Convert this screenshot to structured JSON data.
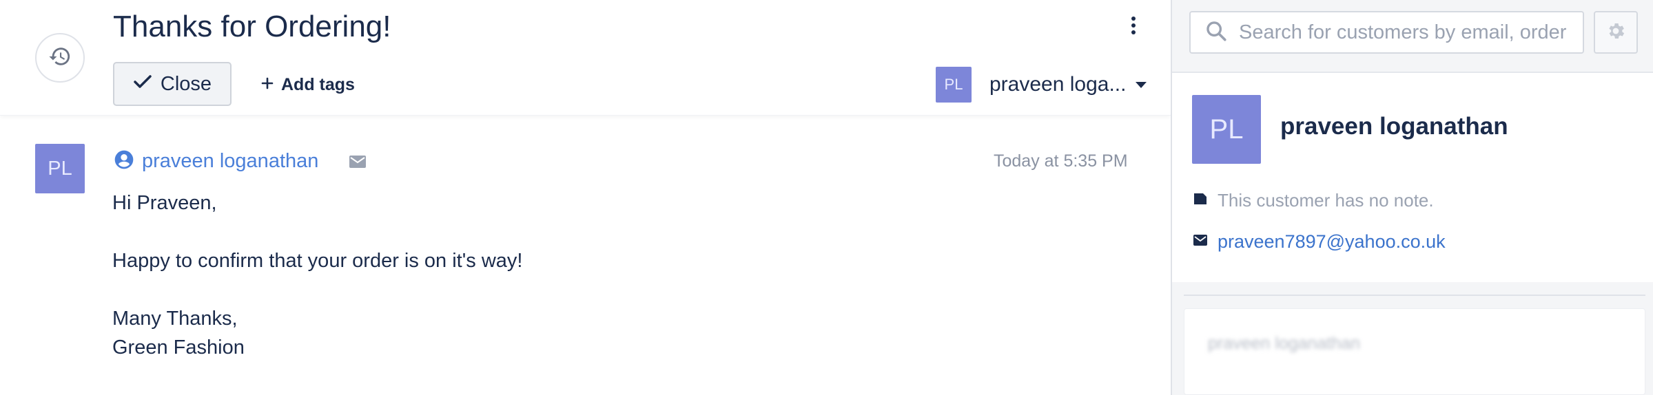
{
  "ticket": {
    "title": "Thanks for Ordering!",
    "close_label": "Close",
    "add_tags_label": "Add tags",
    "assignee": {
      "initials": "PL",
      "name": "praveen loga..."
    }
  },
  "message": {
    "avatar_initials": "PL",
    "sender_name": "praveen loganathan",
    "timestamp": "Today at 5:35 PM",
    "lines": [
      "Hi Praveen,",
      "Happy to confirm that your order is on it's way!",
      "Many Thanks,",
      "Green Fashion"
    ]
  },
  "sidebar": {
    "search_placeholder": "Search for customers by email, order",
    "customer": {
      "initials": "PL",
      "name": "praveen loganathan",
      "note": "This customer has no note.",
      "email": "praveen7897@yahoo.co.uk"
    },
    "blurred_card_text": "praveen loganathan"
  },
  "colors": {
    "avatar": "#7d86d9",
    "link": "#4a7fd9",
    "text": "#1b2b4b",
    "muted": "#9aa2b1"
  },
  "icons": [
    "history-icon",
    "kebab-menu-icon",
    "checkmark-icon",
    "plus-icon",
    "caret-down-icon",
    "user-circle-icon",
    "mail-icon",
    "search-icon",
    "gear-icon",
    "note-tag-icon"
  ]
}
